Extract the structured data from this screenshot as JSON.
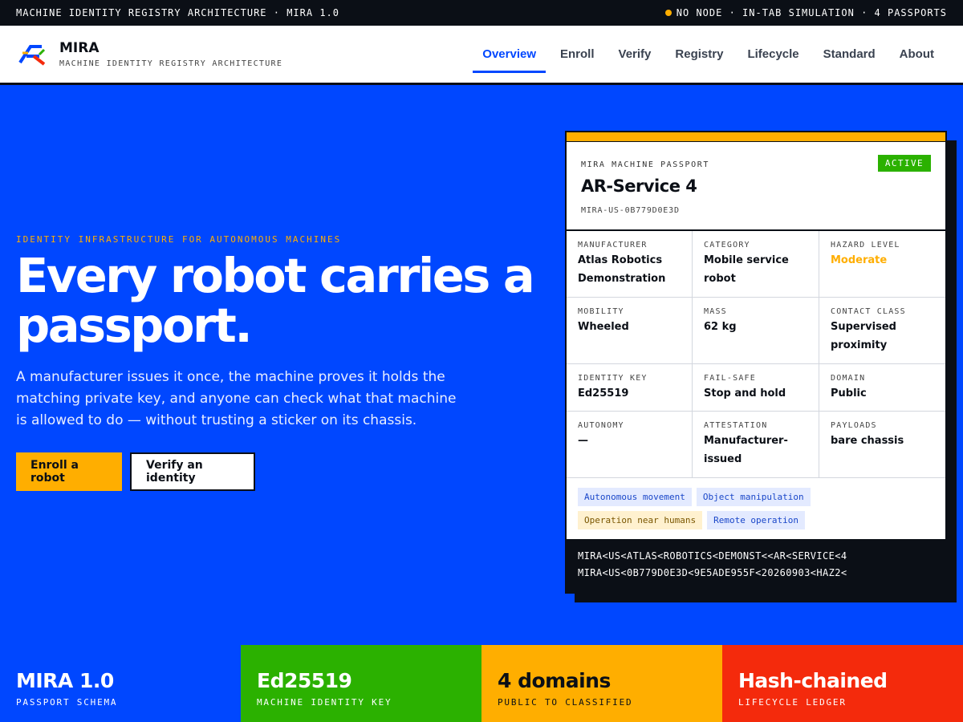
{
  "topbar": {
    "left_text": "MACHINE IDENTITY REGISTRY ARCHITECTURE · MIRA 1.0",
    "status_text": "NO NODE · IN-TAB SIMULATION · 4 PASSPORTS",
    "status_color": "#ffae00"
  },
  "brand": {
    "name": "MIRA",
    "subtitle": "MACHINE IDENTITY REGISTRY ARCHITECTURE",
    "logo_icon": "mira-r-logo-icon"
  },
  "nav": {
    "items": [
      {
        "label": "Overview",
        "active": true
      },
      {
        "label": "Enroll"
      },
      {
        "label": "Verify"
      },
      {
        "label": "Registry"
      },
      {
        "label": "Lifecycle"
      },
      {
        "label": "Standard"
      },
      {
        "label": "About"
      }
    ]
  },
  "hero": {
    "eyebrow": "IDENTITY INFRASTRUCTURE FOR AUTONOMOUS MACHINES",
    "headline": "Every robot carries a passport.",
    "lede": "A manufacturer issues it once, the machine proves it holds the matching private key, and anyone can check what that machine is allowed to do — without trusting a sticker on its chassis.",
    "primary_button": "Enroll a robot",
    "secondary_button": "Verify an identity"
  },
  "passport": {
    "label": "MIRA MACHINE PASSPORT",
    "name": "AR-Service 4",
    "id": "MIRA-US-0B779D0E3D",
    "status": "ACTIVE",
    "fields": [
      {
        "label": "MANUFACTURER",
        "value": "Atlas Robotics Demonstration"
      },
      {
        "label": "CATEGORY",
        "value": "Mobile service robot"
      },
      {
        "label": "HAZARD LEVEL",
        "value": "Moderate"
      },
      {
        "label": "MOBILITY",
        "value": "Wheeled"
      },
      {
        "label": "MASS",
        "value": "62 kg"
      },
      {
        "label": "CONTACT CLASS",
        "value": "Supervised proximity"
      },
      {
        "label": "IDENTITY KEY",
        "value": "Ed25519"
      },
      {
        "label": "FAIL-SAFE",
        "value": "Stop and hold"
      },
      {
        "label": "DOMAIN",
        "value": "Public"
      },
      {
        "label": "AUTONOMY",
        "value": "—"
      },
      {
        "label": "ATTESTATION",
        "value": "Manufacturer-issued"
      },
      {
        "label": "PAYLOADS",
        "value": "bare chassis"
      }
    ],
    "capabilities": [
      {
        "label": "Autonomous movement",
        "tone": "info"
      },
      {
        "label": "Object manipulation",
        "tone": "info"
      },
      {
        "label": "Operation near humans",
        "tone": "warn"
      },
      {
        "label": "Remote operation",
        "tone": "info"
      }
    ],
    "mrz": [
      "MIRA<US<ATLAS<ROBOTICS<DEMONST<<AR<SERVICE<4",
      "MIRA<US<0B779D0E3D<9E5ADE955F<20260903<HAZ2<"
    ]
  },
  "stats": [
    {
      "value": "MIRA 1.0",
      "label": "PASSPORT SCHEMA",
      "bg": "#0047ff",
      "fg": "#ffffff"
    },
    {
      "value": "Ed25519",
      "label": "MACHINE IDENTITY KEY",
      "bg": "#2bb100",
      "fg": "#ffffff"
    },
    {
      "value": "4 domains",
      "label": "PUBLIC TO CLASSIFIED",
      "bg": "#ffae00",
      "fg": "#0b0f16"
    },
    {
      "value": "Hash-chained",
      "label": "LIFECYCLE LEDGER",
      "bg": "#f42a0c",
      "fg": "#ffffff"
    }
  ],
  "colors": {
    "brand_blue": "#0047ff",
    "accent_yellow": "#ffae00",
    "ink": "#0b0f16",
    "green": "#2bb100",
    "red": "#f42a0c"
  }
}
